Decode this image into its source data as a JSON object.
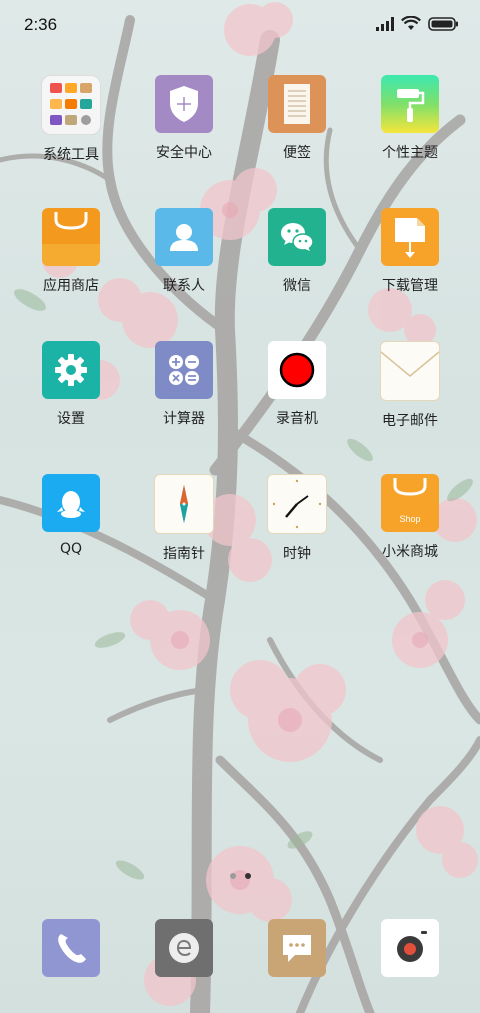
{
  "status_bar": {
    "time": "2:36",
    "icons": [
      "signal-icon",
      "wifi-icon",
      "battery-icon"
    ]
  },
  "apps": [
    {
      "name": "system-tools",
      "label": "系统工具",
      "icon": "folder-icon"
    },
    {
      "name": "security-center",
      "label": "安全中心",
      "icon": "shield-icon"
    },
    {
      "name": "notes",
      "label": "便签",
      "icon": "notepad-icon"
    },
    {
      "name": "themes",
      "label": "个性主题",
      "icon": "paint-roller-icon"
    },
    {
      "name": "app-store",
      "label": "应用商店",
      "icon": "shopping-bag-icon"
    },
    {
      "name": "contacts",
      "label": "联系人",
      "icon": "person-icon"
    },
    {
      "name": "wechat",
      "label": "微信",
      "icon": "wechat-icon"
    },
    {
      "name": "downloads",
      "label": "下载管理",
      "icon": "download-icon"
    },
    {
      "name": "settings",
      "label": "设置",
      "icon": "gear-icon"
    },
    {
      "name": "calculator",
      "label": "计算器",
      "icon": "calculator-icon"
    },
    {
      "name": "recorder",
      "label": "录音机",
      "icon": "record-icon"
    },
    {
      "name": "email",
      "label": "电子邮件",
      "icon": "envelope-icon"
    },
    {
      "name": "qq",
      "label": "QQ",
      "icon": "qq-penguin-icon"
    },
    {
      "name": "compass",
      "label": "指南针",
      "icon": "compass-icon"
    },
    {
      "name": "clock",
      "label": "时钟",
      "icon": "clock-icon"
    },
    {
      "name": "mi-store",
      "label": "小米商城",
      "icon": "shop-bag-icon",
      "badge_text": "Shop"
    }
  ],
  "dock": [
    {
      "name": "phone",
      "icon": "phone-icon"
    },
    {
      "name": "browser",
      "icon": "browser-icon"
    },
    {
      "name": "messages",
      "icon": "message-icon"
    },
    {
      "name": "camera",
      "icon": "camera-icon"
    }
  ],
  "page_indicator": {
    "pages": 2,
    "current": 2
  }
}
